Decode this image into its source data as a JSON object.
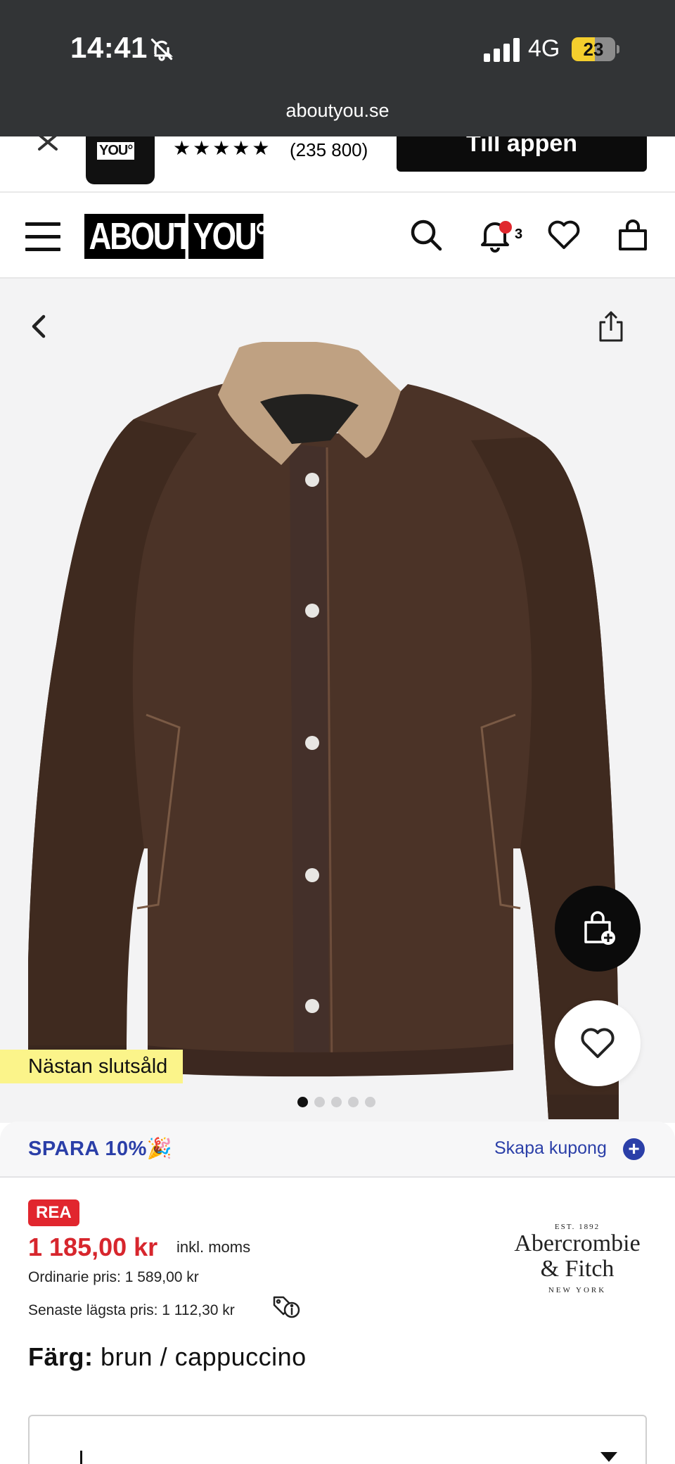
{
  "status_bar": {
    "time": "14:41",
    "network": "4G",
    "battery": "23",
    "url": "aboutyou.se",
    "icons": [
      "bell-slash-icon",
      "signal-icon",
      "battery-icon"
    ]
  },
  "app_banner": {
    "rating_stars": "★★★★★",
    "rating_count": "(235 800)",
    "logo_text": "YOU°",
    "cta_label": "Till appen"
  },
  "header": {
    "logo_part1": "ABOUT",
    "logo_part2": "YOU°",
    "notification_count": "3",
    "icons": [
      "menu-icon",
      "search-icon",
      "bell-icon",
      "heart-icon",
      "bag-icon"
    ]
  },
  "gallery": {
    "badge": "Nästan slutsåld",
    "image_count": 5,
    "active_index": 0
  },
  "coupon": {
    "offer": "SPARA 10%🎉",
    "action": "Skapa kupong",
    "plus": "+"
  },
  "product": {
    "sale_badge": "REA",
    "price": "1 185,00 kr",
    "vat_note": "inkl. moms",
    "ordinary_price": "Ordinarie pris: 1 589,00 kr",
    "lowest_price": "Senaste lägsta pris:  1 112,30 kr",
    "color_label": "Färg:",
    "color_value": "brun / cappuccino"
  },
  "brand": {
    "established": "EST. 1892",
    "name_line1": "Abercrombie",
    "name_line2": "& Fitch",
    "city": "NEW YORK"
  },
  "colors": {
    "accent_blue": "#2b3fa8",
    "sale_red": "#e1262e",
    "badge_yellow": "#fbf48a"
  }
}
